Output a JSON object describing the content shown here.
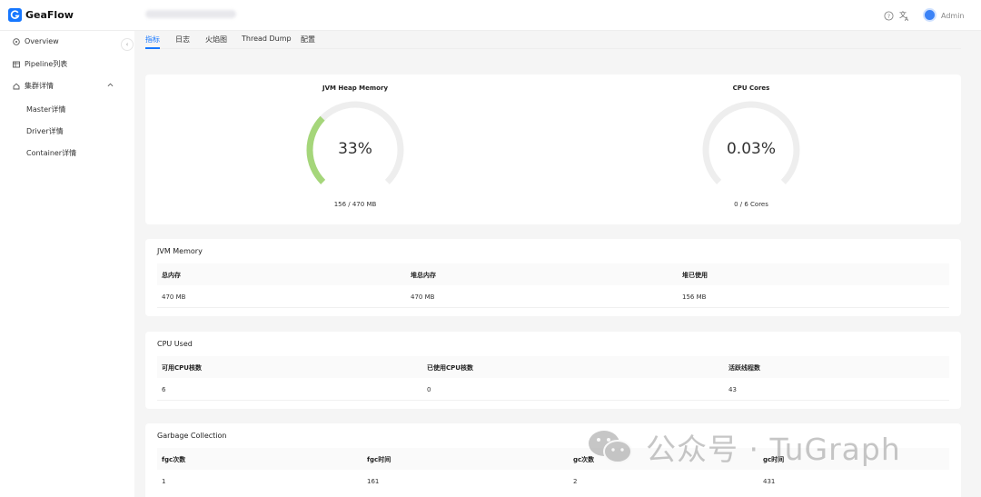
{
  "app": {
    "name": "GeaFlow",
    "user": "Admin"
  },
  "sidebar": {
    "items": [
      {
        "label": "Overview"
      },
      {
        "label": "Pipeline列表"
      },
      {
        "label": "集群详情"
      }
    ],
    "sub_items": [
      {
        "label": "Master详情"
      },
      {
        "label": "Driver详情"
      },
      {
        "label": "Container详情"
      }
    ]
  },
  "tabs": [
    {
      "label": "指标",
      "active": true
    },
    {
      "label": "日志"
    },
    {
      "label": "火焰图"
    },
    {
      "label": "Thread Dump"
    },
    {
      "label": "配置"
    }
  ],
  "gauges": [
    {
      "title": "JVM Heap Memory",
      "value": "33%",
      "percent": 33,
      "detail": "156 / 470 MB"
    },
    {
      "title": "CPU Cores",
      "value": "0.03%",
      "percent": 0.03,
      "detail": "0 / 6 Cores"
    }
  ],
  "jvm_memory": {
    "title": "JVM Memory",
    "headers": [
      "总内存",
      "堆总内存",
      "堆已使用"
    ],
    "row": [
      "470 MB",
      "470 MB",
      "156 MB"
    ]
  },
  "cpu_used": {
    "title": "CPU Used",
    "headers": [
      "可用CPU核数",
      "已使用CPU核数",
      "活跃线程数"
    ],
    "row": [
      "6",
      "0",
      "43"
    ]
  },
  "gc": {
    "title": "Garbage Collection",
    "headers": [
      "fgc次数",
      "fgc时间",
      "gc次数",
      "gc时间"
    ],
    "row": [
      "1",
      "161",
      "2",
      "431"
    ]
  },
  "watermark": {
    "text": "公众号 · TuGraph"
  },
  "colors": {
    "accent": "#1677ff",
    "gauge_green": "#a5d67a",
    "gauge_track": "#eeeeee"
  }
}
